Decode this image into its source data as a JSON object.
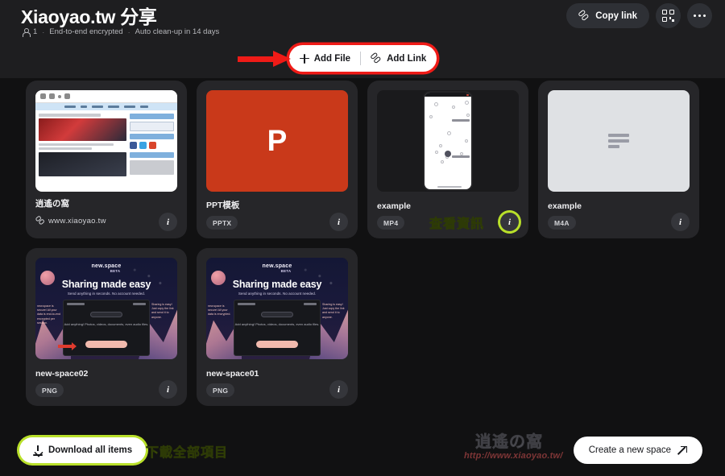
{
  "header": {
    "title": "Xiaoyao.tw 分享",
    "meta": {
      "members": "1",
      "encryption": "End-to-end encrypted",
      "cleanup": "Auto clean-up in 14 days",
      "separator": "·"
    },
    "copy_link_label": "Copy link",
    "qr_icon": "qr-code-icon",
    "more_icon": "more-horizontal-icon"
  },
  "toolbar": {
    "add_file_label": "Add File",
    "add_link_label": "Add Link",
    "annotation_color": "#ef1b17"
  },
  "annotations": {
    "view_info": "查看資訊",
    "download_all": "下載全部項目",
    "green_color": "#b9e02a"
  },
  "items": [
    {
      "title": "逍遙の窩",
      "badge": "www.xiaoyao.tw",
      "type": "link",
      "info_label": "i"
    },
    {
      "title": "PPT模板",
      "badge": "PPTX",
      "type": "pptx",
      "thumb_letter": "P",
      "info_label": "i"
    },
    {
      "title": "example",
      "badge": "MP4",
      "type": "mp4",
      "info_label": "i"
    },
    {
      "title": "example",
      "badge": "M4A",
      "type": "m4a",
      "info_label": "i"
    },
    {
      "title": "new-space02",
      "badge": "PNG",
      "type": "png",
      "promo": {
        "brand": "new.space",
        "beta": "BETA",
        "headline": "Sharing made easy",
        "sub": "Send anything in seconds. No account needed.",
        "window_title": "Untitled space",
        "mid_text": "Add anything! Photos, videos, documents, even audio files.",
        "ann_left": "new.space is secure! All your data is end-to-end encrypted per session.",
        "ann_right": "Sharing is easy! Just copy the link and send it to anyone."
      },
      "info_label": "i"
    },
    {
      "title": "new-space01",
      "badge": "PNG",
      "type": "png",
      "promo": {
        "brand": "new.space",
        "beta": "BETA",
        "headline": "Sharing made easy",
        "sub": "Send anything in seconds. No account needed.",
        "window_title": "Untitled space",
        "mid_text": "Add anything! Photos, videos, documents, even audio files.",
        "ann_left": "new.space is secure! All your data is encrypted.",
        "ann_right": "Sharing is easy! Just copy the link and send it to anyone."
      },
      "info_label": "i"
    }
  ],
  "footer": {
    "download_label": "Download all items",
    "create_label": "Create a new space"
  },
  "watermark": {
    "line1": "逍遙の窩",
    "line2": "http://www.xiaoyao.tw/"
  }
}
